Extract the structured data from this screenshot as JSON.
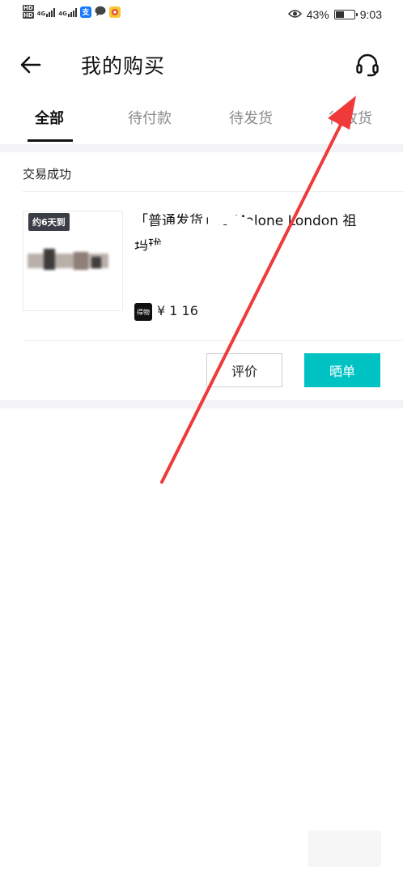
{
  "status_bar": {
    "hd1": "HD",
    "hd2": "HD",
    "net1": "4G",
    "net2": "4G",
    "alipay_glyph": "支",
    "battery": "43%",
    "time": "9:03",
    "icons": [
      "signal-icon",
      "alipay-icon",
      "message-icon",
      "app-icon",
      "eye-icon",
      "battery-icon"
    ]
  },
  "header": {
    "title": "我的购买",
    "back_icon": "arrow-left-icon",
    "service_icon": "headset-icon"
  },
  "tabs": [
    {
      "label": "全部",
      "active": true
    },
    {
      "label": "待付款",
      "active": false
    },
    {
      "label": "待发货",
      "active": false
    },
    {
      "label": "待收货",
      "active": false
    }
  ],
  "order": {
    "status": "交易成功",
    "eta_badge": "约6天到",
    "title_line1": "「普通发货」Jo Malone London 祖",
    "title_line2": "玛珑",
    "shop_glyph": "得物",
    "price": "¥ 1 16",
    "review_button": "评价",
    "share_button": "晒单"
  },
  "colors": {
    "accent": "#01c2c3",
    "badge_bg": "#3b3d47",
    "annotation_arrow": "#f03a3a",
    "band": "#f3f3f6"
  }
}
